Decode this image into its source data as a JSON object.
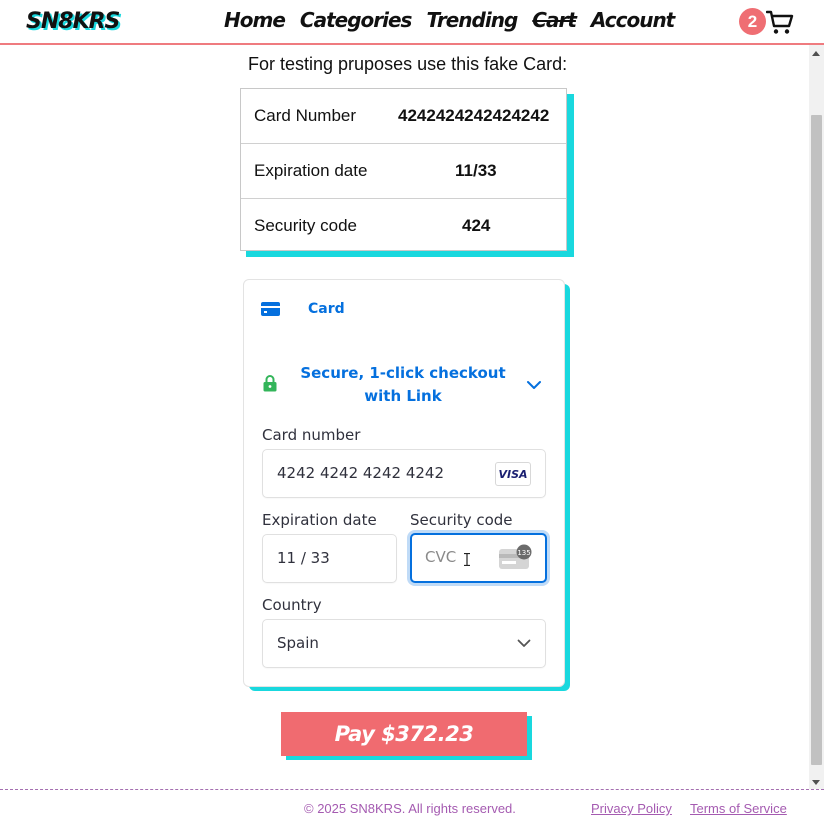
{
  "header": {
    "logo": "SN8KRS",
    "nav": [
      "Home",
      "Categories",
      "Trending",
      "Cart",
      "Account"
    ],
    "cart_count": "2",
    "accent": "#19d8de",
    "brand_red": "#ef6e73"
  },
  "test_card": {
    "title": "For testing pruposes use this fake Card:",
    "rows": [
      {
        "label": "Card Number",
        "value": "4242424242424242"
      },
      {
        "label": "Expiration date",
        "value": "11/33"
      },
      {
        "label": "Security code",
        "value": "424"
      }
    ]
  },
  "payment_form": {
    "tab_label": "Card",
    "tab_icon": "credit-card-icon",
    "link_text": "Secure, 1-click checkout with Link",
    "card_number_label": "Card number",
    "card_number_value": "4242 4242 4242 4242",
    "card_brand": "VISA",
    "expiration_label": "Expiration date",
    "expiration_value": "11 / 33",
    "security_label": "Security code",
    "security_placeholder": "CVC",
    "cvc_icon_text": "135",
    "country_label": "Country",
    "country_value": "Spain",
    "link_color": "#0570de"
  },
  "pay_button": {
    "label": "Pay $372.23"
  },
  "footer": {
    "copyright": "© 2025 SN8KRS. All rights reserved.",
    "privacy": "Privacy Policy",
    "terms": "Terms of Service"
  }
}
